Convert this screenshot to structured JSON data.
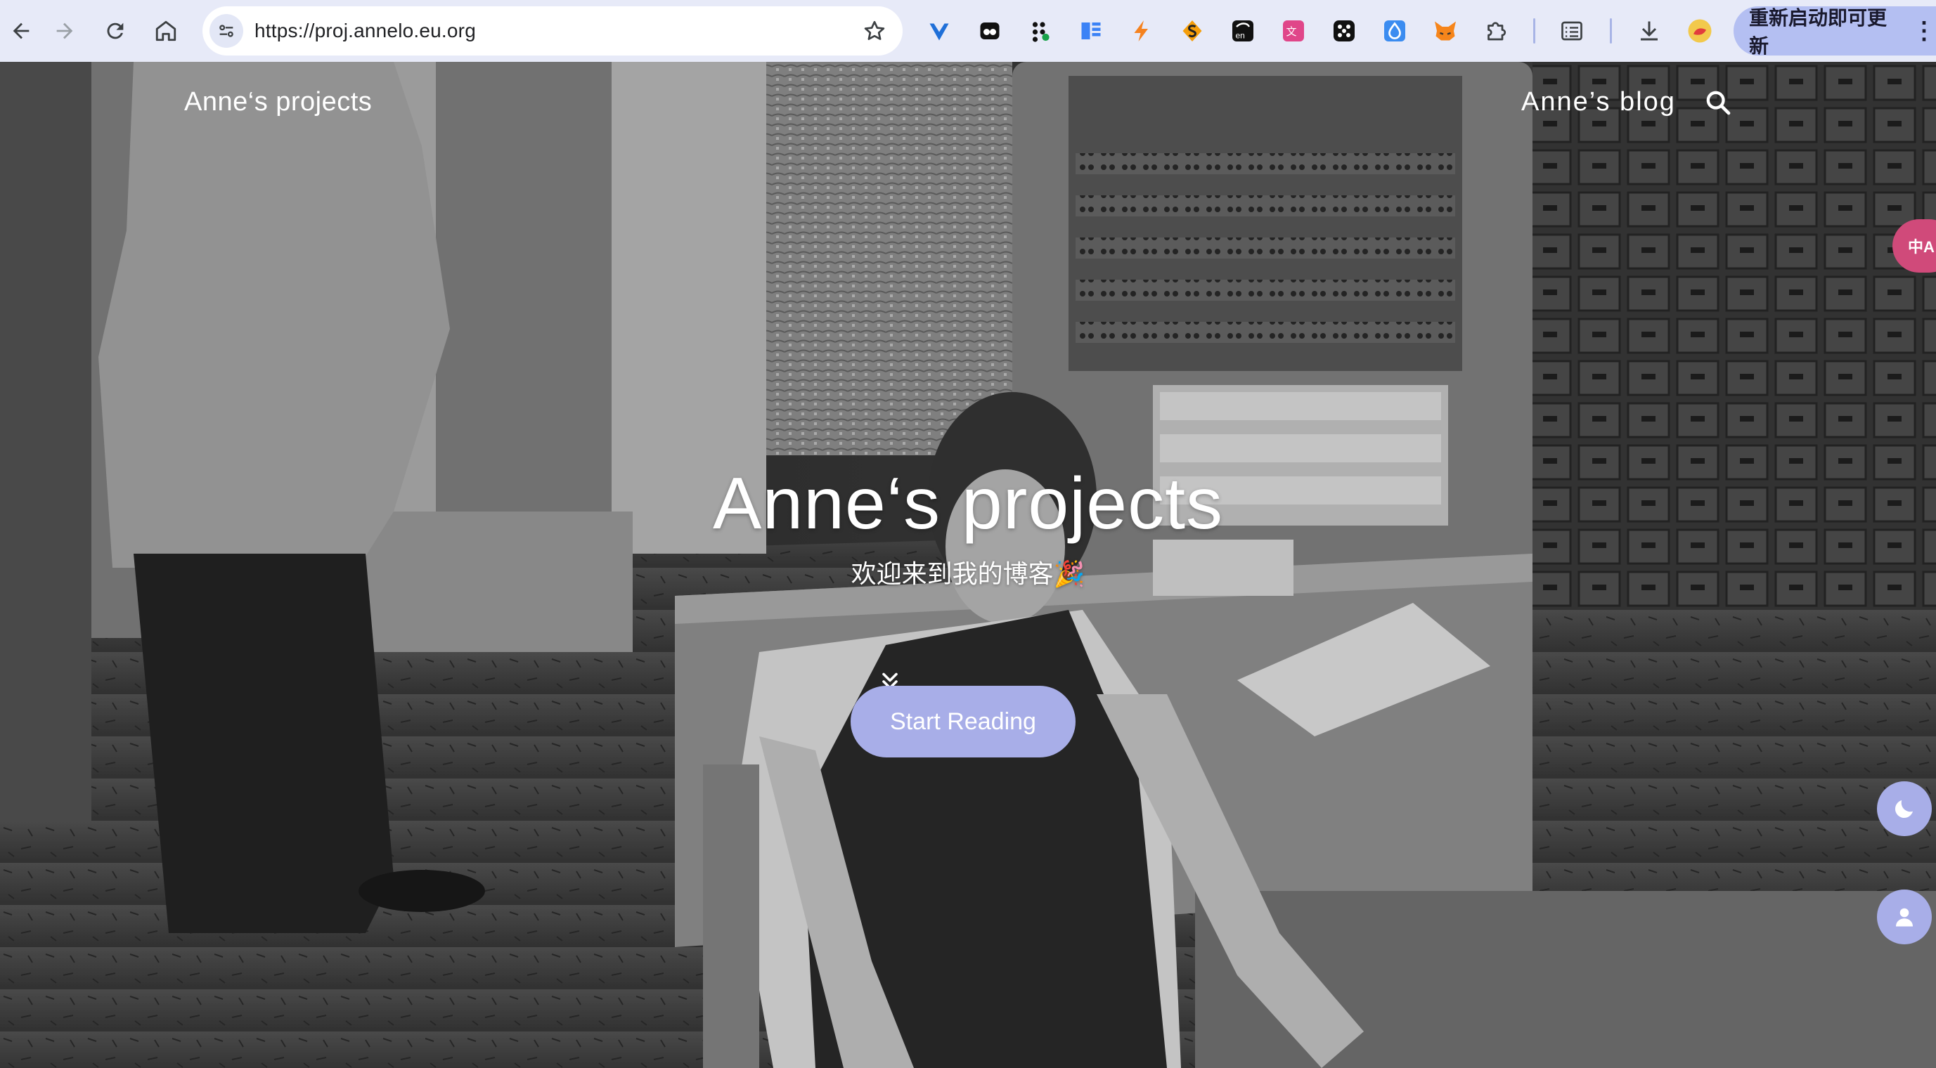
{
  "browser": {
    "url": "https://proj.annelo.eu.org",
    "update_button_label": "重新启动即可更新",
    "update_menu_glyph": "⋮",
    "nav_icons": [
      "back-arrow-icon",
      "forward-arrow-icon",
      "reload-icon",
      "home-icon"
    ],
    "omnibox_icons": [
      "site-settings-icon",
      "bookmark-star-icon"
    ],
    "extension_icons": [
      "heart-extension-icon",
      "ghost-extension-icon",
      "dots-extension-icon",
      "reader-extension-icon",
      "bolt-extension-icon",
      "s-extension-icon",
      "translate-en-extension-icon",
      "translate-zh-extension-icon",
      "dice-extension-icon",
      "drop-extension-icon",
      "fox-extension-icon",
      "puzzle-extensions-icon",
      "reading-list-icon",
      "download-icon",
      "profile-avatar-icon"
    ]
  },
  "site": {
    "title": "Anne‘s projects",
    "blog_link": "Anne’s blog"
  },
  "hero": {
    "title": "Anne‘s projects",
    "subtitle": "欢迎来到我的博客🎉",
    "cta_label": "Start Reading"
  },
  "floating": {
    "translate_label": "中A",
    "darkmode_icon": "moon-icon",
    "user_icon": "user-icon"
  },
  "colors": {
    "chrome_bg": "#e7eaf8",
    "accent": "#a8aee8",
    "update_pill": "#b4bff2"
  }
}
